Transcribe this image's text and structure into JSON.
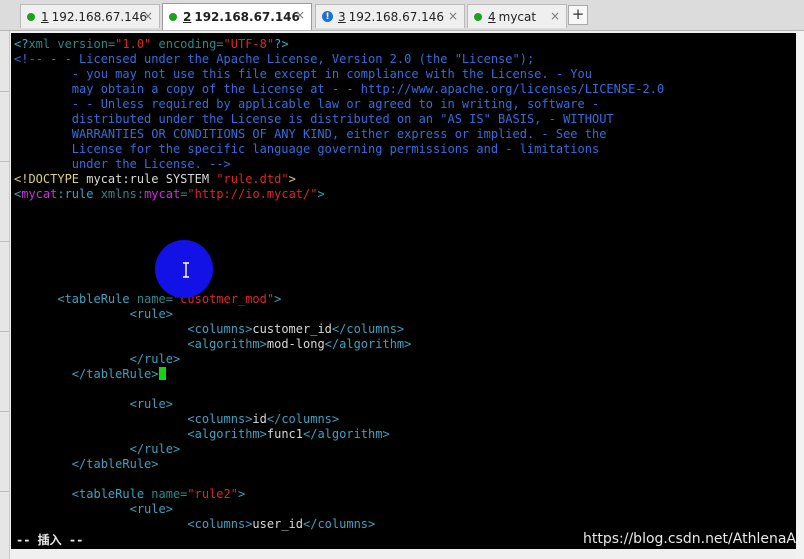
{
  "tabs": [
    {
      "num": "1",
      "label": "192.168.67.146",
      "status": "connected",
      "active": false,
      "close": "×"
    },
    {
      "num": "2",
      "label": "192.168.67.146",
      "status": "connected",
      "active": true,
      "close": "×"
    },
    {
      "num": "3",
      "label": "192.168.67.146",
      "status": "warning",
      "active": false,
      "close": "×"
    },
    {
      "num": "4",
      "label": "mycat",
      "status": "connected",
      "active": false,
      "close": "×"
    }
  ],
  "new_tab_label": "+",
  "warn_glyph": "!",
  "terminal": {
    "l01": {
      "a": "<?",
      "b": "xml version=",
      "c": "\"1.0\"",
      "d": " encoding=",
      "e": "\"UTF-8\"",
      "f": "?>"
    },
    "l02": "<!-- - - Licensed under the Apache License, Version 2.0 (the \"License\");",
    "l03": "        - you may not use this file except in compliance with the License. - You",
    "l04": "        may obtain a copy of the License at - - http://www.apache.org/licenses/LICENSE-2.0",
    "l05": "        - - Unless required by applicable law or agreed to in writing, software -",
    "l06": "        distributed under the License is distributed on an \"AS IS\" BASIS, - WITHOUT",
    "l07": "        WARRANTIES OR CONDITIONS OF ANY KIND, either express or implied. - See the",
    "l08": "        License for the specific language governing permissions and - limitations",
    "l09": "        under the License. -->",
    "l10": {
      "a": "<!DOCTYPE",
      "b": " mycat:rule SYSTEM ",
      "c": "\"rule.dtd\"",
      "d": ">"
    },
    "l11": {
      "a": "<",
      "b": "mycat",
      "c": ":rule",
      "d": " xmlns:",
      "e": "mycat",
      "f": "=",
      "g": "\"http://io.mycat/\"",
      "h": ">"
    },
    "l12": {
      "a": "      <tableRule",
      "b": " name=",
      "c": "\"cusotmer_mod\"",
      "d": ">"
    },
    "l13": "                <rule>",
    "l14": {
      "a": "                        <columns>",
      "b": "customer_id",
      "c": "</columns>"
    },
    "l15": {
      "a": "                        <algorithm>",
      "b": "mod-long",
      "c": "</algorithm>"
    },
    "l16": "                </rule>",
    "l17": "        </tableRule>",
    "l18": "                <rule>",
    "l19": {
      "a": "                        <columns>",
      "b": "id",
      "c": "</columns>"
    },
    "l20": {
      "a": "                        <algorithm>",
      "b": "func1",
      "c": "</algorithm>"
    },
    "l21": "                </rule>",
    "l22": "        </tableRule>",
    "l23": {
      "a": "        <tableRule",
      "b": " name=",
      "c": "\"rule2\"",
      "d": ">"
    },
    "l24": "                <rule>",
    "l25": {
      "a": "                        <columns>",
      "b": "user_id",
      "c": "</columns>"
    },
    "status": "-- 插入 --"
  },
  "watermark": "https://blog.csdn.net/AthlenaA"
}
